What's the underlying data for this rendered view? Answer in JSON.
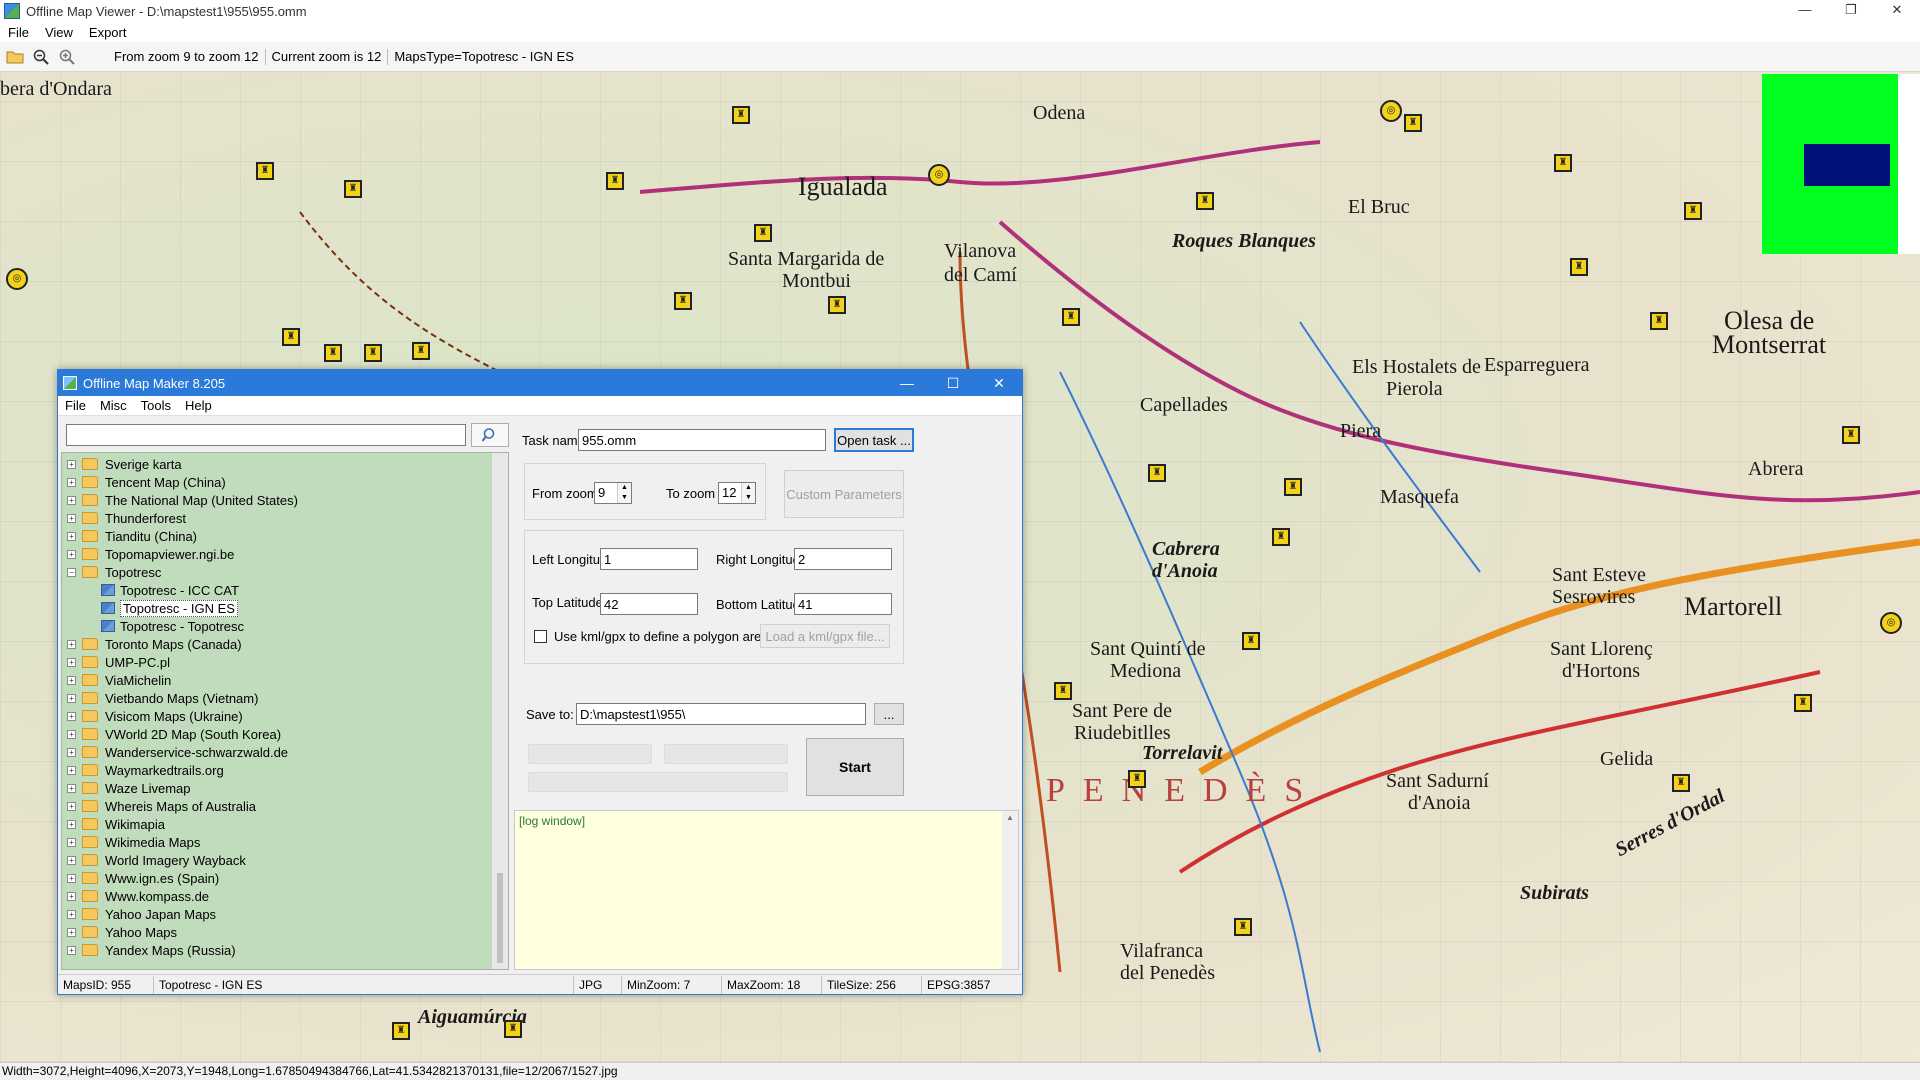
{
  "viewer": {
    "title": "Offline Map Viewer - D:\\mapstest1\\955\\955.omm",
    "window_buttons": [
      "—",
      "❐",
      "✕"
    ],
    "menu": [
      "File",
      "View",
      "Export"
    ],
    "toolbar": {
      "zoom_range": "From zoom 9 to zoom 12",
      "current_zoom": "Current zoom is 12",
      "maps_type": "MapsType=Topotresc - IGN ES"
    },
    "status": "Width=3072,Height=4096,X=2073,Y=1948,Long=1.67850494384766,Lat=41.5342821370131,file=12/2067/1527.jpg"
  },
  "map": {
    "labels": [
      {
        "text": "bera d'Ondara",
        "cls": "mid"
      },
      {
        "text": "Igualada",
        "cls": "big"
      },
      {
        "text": "Santa Margarida de",
        "cls": "mid"
      },
      {
        "text": "Montbui",
        "cls": "mid"
      },
      {
        "text": "Vilanova",
        "cls": "mid"
      },
      {
        "text": "del Camí",
        "cls": "mid"
      },
      {
        "text": "Odena",
        "cls": "mid"
      },
      {
        "text": "Roques Blanques",
        "cls": "mid bold"
      },
      {
        "text": "El Bruc",
        "cls": "mid"
      },
      {
        "text": "Olesa de",
        "cls": "big"
      },
      {
        "text": "Montserrat",
        "cls": "big"
      },
      {
        "text": "Els Hostalets de",
        "cls": "mid"
      },
      {
        "text": "Pierola",
        "cls": "mid"
      },
      {
        "text": "Esparreguera",
        "cls": "mid"
      },
      {
        "text": "Capellades",
        "cls": "mid"
      },
      {
        "text": "Piera",
        "cls": "mid"
      },
      {
        "text": "Masquefa",
        "cls": "mid"
      },
      {
        "text": "Abrera",
        "cls": "mid"
      },
      {
        "text": "Cabrera",
        "cls": "mid bold"
      },
      {
        "text": "d'Anoia",
        "cls": "mid bold"
      },
      {
        "text": "Martorell",
        "cls": "big"
      },
      {
        "text": "Sant Esteve",
        "cls": "mid"
      },
      {
        "text": "Sesrovires",
        "cls": "mid"
      },
      {
        "text": "Sant Llorenç",
        "cls": "mid"
      },
      {
        "text": "d'Hortons",
        "cls": "mid"
      },
      {
        "text": "Sant Quintí de",
        "cls": "mid"
      },
      {
        "text": "Mediona",
        "cls": "mid"
      },
      {
        "text": "Sant Pere de",
        "cls": "mid"
      },
      {
        "text": "Riudebitlles",
        "cls": "mid"
      },
      {
        "text": "Torrelavit",
        "cls": "mid bold"
      },
      {
        "text": "Sant Sadurní",
        "cls": "mid"
      },
      {
        "text": "d'Anoia",
        "cls": "mid"
      },
      {
        "text": "Gelida",
        "cls": "mid"
      },
      {
        "text": "Serres d'Ordal",
        "cls": "mid bold"
      },
      {
        "text": "Subirats",
        "cls": "mid bold"
      },
      {
        "text": "Aiguamúrcia",
        "cls": "mid bold"
      },
      {
        "text": "Vilafranca",
        "cls": "mid"
      },
      {
        "text": "del Penedès",
        "cls": "mid"
      },
      {
        "text": "PENEDÈS",
        "cls": "region"
      }
    ]
  },
  "maker": {
    "title": "Offline Map Maker 8.205",
    "window_buttons": [
      "—",
      "☐",
      "✕"
    ],
    "menu": [
      "File",
      "Misc",
      "Tools",
      "Help"
    ],
    "search_value": "",
    "tree": [
      {
        "label": "Sverige karta",
        "type": "folder",
        "exp": "+"
      },
      {
        "label": "Tencent Map (China)",
        "type": "folder",
        "exp": "+"
      },
      {
        "label": "The National Map (United States)",
        "type": "folder",
        "exp": "+"
      },
      {
        "label": "Thunderforest",
        "type": "folder",
        "exp": "+"
      },
      {
        "label": "Tianditu (China)",
        "type": "folder",
        "exp": "+"
      },
      {
        "label": "Topomapviewer.ngi.be",
        "type": "folder",
        "exp": "+"
      },
      {
        "label": "Topotresc",
        "type": "folder",
        "exp": "−"
      },
      {
        "label": "Topotresc - ICC CAT",
        "type": "map"
      },
      {
        "label": "Topotresc - IGN ES",
        "type": "map",
        "selected": true
      },
      {
        "label": "Topotresc - Topotresc",
        "type": "map"
      },
      {
        "label": "Toronto Maps (Canada)",
        "type": "folder",
        "exp": "+"
      },
      {
        "label": "UMP-PC.pl",
        "type": "folder",
        "exp": "+"
      },
      {
        "label": "ViaMichelin",
        "type": "folder",
        "exp": "+"
      },
      {
        "label": "Vietbando Maps (Vietnam)",
        "type": "folder",
        "exp": "+"
      },
      {
        "label": "Visicom Maps (Ukraine)",
        "type": "folder",
        "exp": "+"
      },
      {
        "label": "VWorld 2D Map (South Korea)",
        "type": "folder",
        "exp": "+"
      },
      {
        "label": "Wanderservice-schwarzwald.de",
        "type": "folder",
        "exp": "+"
      },
      {
        "label": "Waymarkedtrails.org",
        "type": "folder",
        "exp": "+"
      },
      {
        "label": "Waze Livemap",
        "type": "folder",
        "exp": "+"
      },
      {
        "label": "Whereis Maps of Australia",
        "type": "folder",
        "exp": "+"
      },
      {
        "label": "Wikimapia",
        "type": "folder",
        "exp": "+"
      },
      {
        "label": "Wikimedia Maps",
        "type": "folder",
        "exp": "+"
      },
      {
        "label": "World Imagery Wayback",
        "type": "folder",
        "exp": "+"
      },
      {
        "label": "Www.ign.es (Spain)",
        "type": "folder",
        "exp": "+"
      },
      {
        "label": "Www.kompass.de",
        "type": "folder",
        "exp": "+"
      },
      {
        "label": "Yahoo Japan Maps",
        "type": "folder",
        "exp": "+"
      },
      {
        "label": "Yahoo Maps",
        "type": "folder",
        "exp": "+"
      },
      {
        "label": "Yandex Maps (Russia)",
        "type": "folder",
        "exp": "+"
      }
    ],
    "form": {
      "task_name_label": "Task name",
      "task_name_value": "955.omm",
      "open_task": "Open task ...",
      "from_zoom_label": "From zoom",
      "from_zoom_value": "9",
      "to_zoom_label": "To zoom",
      "to_zoom_value": "12",
      "custom_params": "Custom Parameters",
      "left_lon_label": "Left Longitude",
      "left_lon_value": "1",
      "right_lon_label": "Right Longitude",
      "right_lon_value": "2",
      "top_lat_label": "Top Latitude",
      "top_lat_value": "42",
      "bottom_lat_label": "Bottom Latitude",
      "bottom_lat_value": "41",
      "kml_label": "Use kml/gpx to define a polygon area",
      "load_kml": "Load a kml/gpx file...",
      "save_to_label": "Save to:",
      "save_to_value": "D:\\mapstest1\\955\\",
      "browse": "...",
      "start": "Start",
      "log": "[log window]"
    },
    "status": {
      "maps_id": "MapsID: 955",
      "maps_name": "Topotresc - IGN ES",
      "format": "JPG",
      "min_zoom": "MinZoom: 7",
      "max_zoom": "MaxZoom: 18",
      "tile_size": "TileSize: 256",
      "epsg": "EPSG:3857"
    }
  }
}
